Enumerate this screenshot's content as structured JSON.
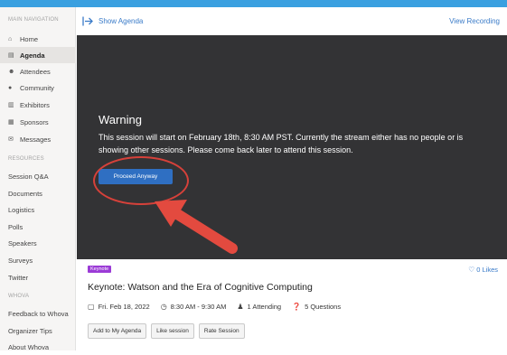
{
  "sidebar": {
    "main_nav_label": "MAIN NAVIGATION",
    "nav_items": [
      {
        "label": "Home",
        "icon": "home-icon",
        "glyph": "⌂"
      },
      {
        "label": "Agenda",
        "icon": "calendar-icon",
        "glyph": "▤",
        "active": true
      },
      {
        "label": "Attendees",
        "icon": "users-icon",
        "glyph": "☻"
      },
      {
        "label": "Community",
        "icon": "chat-icon",
        "glyph": "●"
      },
      {
        "label": "Exhibitors",
        "icon": "building-icon",
        "glyph": "▥"
      },
      {
        "label": "Sponsors",
        "icon": "sponsor-icon",
        "glyph": "▦"
      },
      {
        "label": "Messages",
        "icon": "envelope-icon",
        "glyph": "✉"
      }
    ],
    "resources_label": "RESOURCES",
    "resource_items": [
      "Session Q&A",
      "Documents",
      "Logistics",
      "Polls",
      "Speakers",
      "Surveys",
      "Twitter"
    ],
    "whova_label": "WHOVA",
    "whova_items": [
      "Feedback to Whova",
      "Organizer Tips",
      "About Whova"
    ]
  },
  "header": {
    "show_agenda": "Show Agenda",
    "view_recording": "View Recording"
  },
  "video": {
    "warning_title": "Warning",
    "warning_message": "This session will start on February 18th, 8:30 AM PST. Currently the stream either has no people or is showing other sessions. Please come back later to attend this session.",
    "proceed_label": "Proceed Anyway",
    "annotation_color": "#d6413a"
  },
  "session": {
    "badge": "Keynote",
    "likes": "0 Likes",
    "title": "Keynote: Watson and the Era of Cognitive Computing",
    "date": "Fri. Feb 18, 2022",
    "time": "8:30 AM - 9:30 AM",
    "attending": "1 Attending",
    "questions": "5 Questions",
    "actions": [
      "Add to My Agenda",
      "Like session",
      "Rate Session"
    ]
  }
}
